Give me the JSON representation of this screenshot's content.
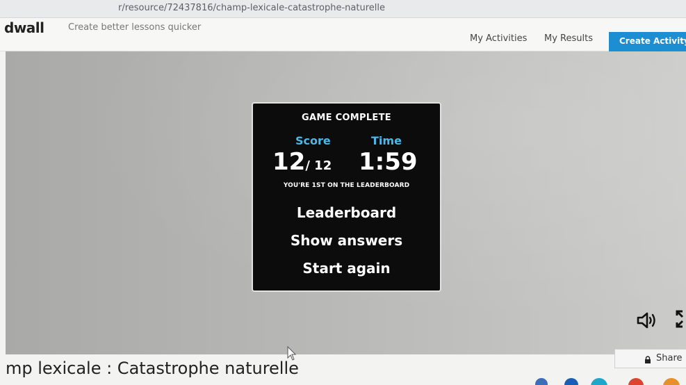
{
  "browser": {
    "url": "r/resource/72437816/champ-lexicale-catastrophe-naturelle"
  },
  "header": {
    "logo": "dwall",
    "tagline": "Create better lessons quicker",
    "nav": {
      "my_activities": "My Activities",
      "my_results": "My Results",
      "create_activity": "Create Activity"
    },
    "accent_color": "#1e8ed2"
  },
  "game": {
    "title": "GAME COMPLETE",
    "score_label": "Score",
    "time_label": "Time",
    "score": "12",
    "score_total": "/ 12",
    "time": "1:59",
    "leaderboard_note": "YOU'RE 1ST ON THE LEADERBOARD",
    "actions": {
      "leaderboard": "Leaderboard",
      "show_answers": "Show answers",
      "start_again": "Start again"
    },
    "label_color": "#4cb8e6",
    "icons": [
      "sound-icon",
      "fullscreen-icon"
    ]
  },
  "page": {
    "title": "mp lexicale : Catastrophe naturelle",
    "share_label": "Share"
  }
}
